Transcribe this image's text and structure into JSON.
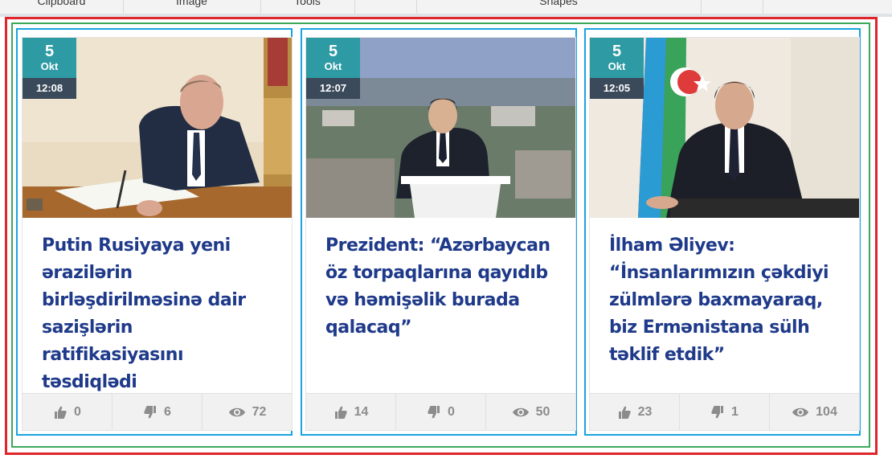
{
  "ribbon": {
    "groups": [
      "Clipboard",
      "Image",
      "Tools",
      "",
      "Shapes",
      ""
    ]
  },
  "cards": [
    {
      "day": "5",
      "month": "Okt",
      "time": "12:08",
      "title": "Putin Rusiyaya yeni ərazilərin birləşdirilməsinə dair sazişlərin ratifikasiyasını təsdiqlədi",
      "likes": "0",
      "dislikes": "6",
      "views": "72"
    },
    {
      "day": "5",
      "month": "Okt",
      "time": "12:07",
      "title": "Prezident: “Azərbaycan öz torpaqlarına qayıdıb və həmişəlik burada qalacaq”",
      "likes": "14",
      "dislikes": "0",
      "views": "50"
    },
    {
      "day": "5",
      "month": "Okt",
      "time": "12:05",
      "title": "İlham Əliyev: “İnsanlarımızın çəkdiyi zülmlərə baxmayaraq, biz Ermənistana sülh təklif etdik”",
      "likes": "23",
      "dislikes": "1",
      "views": "104"
    }
  ]
}
